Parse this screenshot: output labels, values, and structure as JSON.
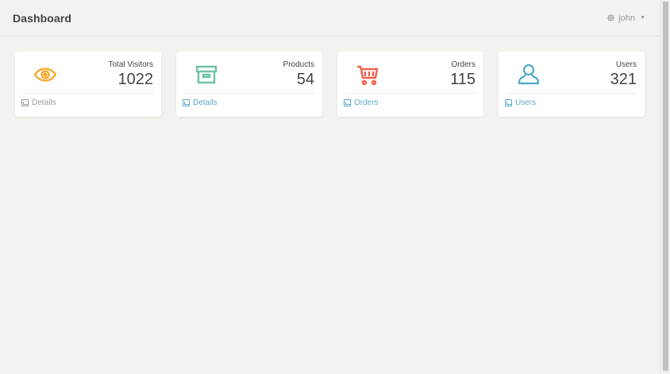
{
  "header": {
    "title": "Dashboard",
    "user_name": "john",
    "user_icon": "gear-icon",
    "caret_icon": "caret-down-icon"
  },
  "cards": [
    {
      "label": "Total Visitors",
      "value": "1022",
      "link": "Details",
      "icon": "eye-icon",
      "accent": "#f5a623",
      "link_color": "#9a9a9a"
    },
    {
      "label": "Products",
      "value": "54",
      "link": "Details",
      "icon": "archive-box-icon",
      "accent": "#6cc3a0",
      "link_color": "#5aa7c9"
    },
    {
      "label": "Orders",
      "value": "115",
      "link": "Orders",
      "icon": "shopping-cart-icon",
      "accent": "#f0624a",
      "link_color": "#5aa7c9"
    },
    {
      "label": "Users",
      "value": "321",
      "link": "Users",
      "icon": "user-icon",
      "accent": "#4aa8c8",
      "link_color": "#5aa7c9"
    }
  ]
}
